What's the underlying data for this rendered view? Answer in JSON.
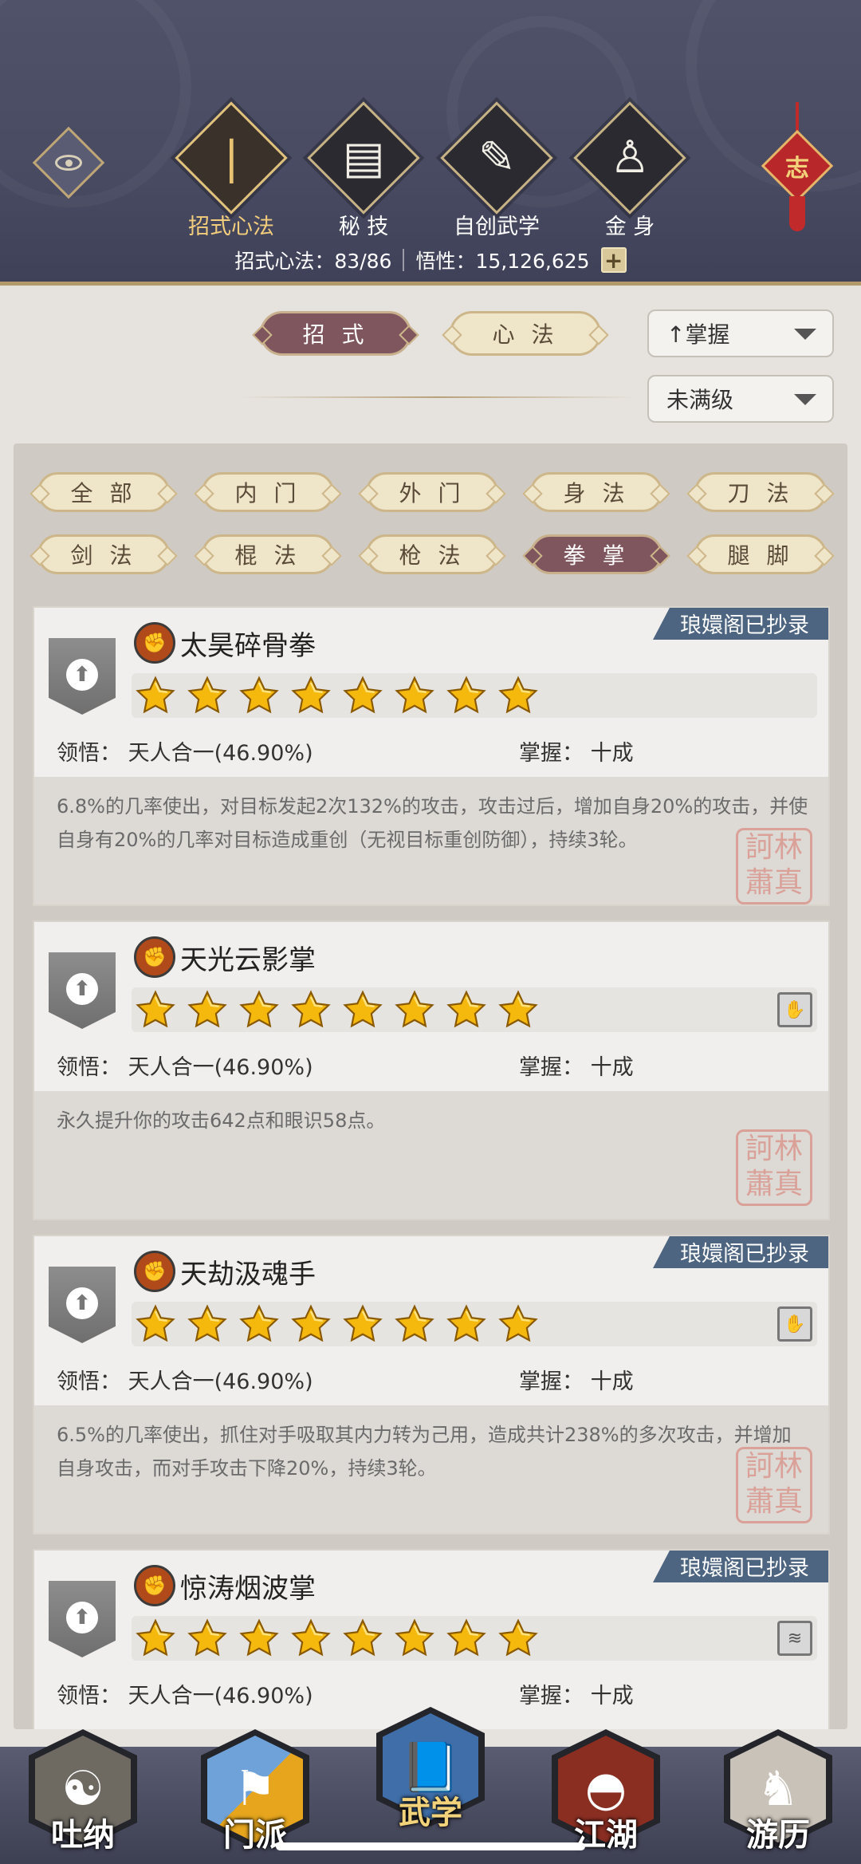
{
  "header": {
    "tabs": [
      {
        "label": "招式心法",
        "icon": "sword-icon",
        "glyph": "🗡"
      },
      {
        "label": "秘 技",
        "icon": "book-icon",
        "glyph": "📖"
      },
      {
        "label": "自创武学",
        "icon": "scroll-icon",
        "glyph": "📜"
      },
      {
        "label": "金 身",
        "icon": "meditation-icon",
        "glyph": "🧘"
      }
    ],
    "charm_text": "志",
    "stats": {
      "moves_label": "招式心法：83/86",
      "insight_label": "悟性：15,126,625",
      "plus": "+"
    }
  },
  "filters": {
    "tab_moves": "招 式",
    "tab_mind": "心 法",
    "sort_dropdown": "↑掌握",
    "level_dropdown": "未满级"
  },
  "categories": [
    "全 部",
    "内 门",
    "外 门",
    "身 法",
    "刀 法",
    "剑 法",
    "棍 法",
    "枪 法",
    "拳 掌",
    "腿 脚"
  ],
  "active_category": "拳 掌",
  "cards": [
    {
      "badge": "琅嬛阁已抄录",
      "name": "太昊碎骨拳",
      "stars": 8,
      "comprehension": "领悟：  天人合一(46.90%)",
      "mastery": "掌握：  十成",
      "desc": "6.8%的几率使出，对目标发起2次132%的攻击，攻击过后，增加自身20%的攻击，并使自身有20%的几率对目标造成重创（无视目标重创防御），持续3轮。",
      "seal": "訶林 蕭真"
    },
    {
      "badge": "",
      "name": "天光云影掌",
      "stars": 8,
      "comprehension": "领悟：  天人合一(46.90%)",
      "mastery": "掌握：  十成",
      "desc": "永久提升你的攻击642点和眼识58点。",
      "seal": "訶林 蕭真"
    },
    {
      "badge": "琅嬛阁已抄录",
      "name": "天劫汲魂手",
      "stars": 8,
      "comprehension": "领悟：  天人合一(46.90%)",
      "mastery": "掌握：  十成",
      "desc": "6.5%的几率使出，抓住对手吸取其内力转为己用，造成共计238%的多次攻击，并增加自身攻击，而对手攻击下降20%，持续3轮。",
      "seal": "訶林 蕭真"
    },
    {
      "badge": "琅嬛阁已抄录",
      "name": "惊涛烟波掌",
      "stars": 8,
      "comprehension": "领悟：  天人合一(46.90%)",
      "mastery": "掌握：  十成",
      "desc": "",
      "seal": ""
    }
  ],
  "bottom_nav": [
    {
      "label": "吐纳",
      "icon": "breathing-figure-icon"
    },
    {
      "label": "门派",
      "icon": "sect-banner-icon"
    },
    {
      "label": "武学",
      "icon": "martial-book-icon"
    },
    {
      "label": "江湖",
      "icon": "straw-hat-icon"
    },
    {
      "label": "游历",
      "icon": "horse-icon"
    }
  ],
  "colors": {
    "header_bg": "#4b4d65",
    "badge_bg": "#4d6580",
    "active_pill": "#7f565e",
    "star_gold": "#f5b90e"
  }
}
